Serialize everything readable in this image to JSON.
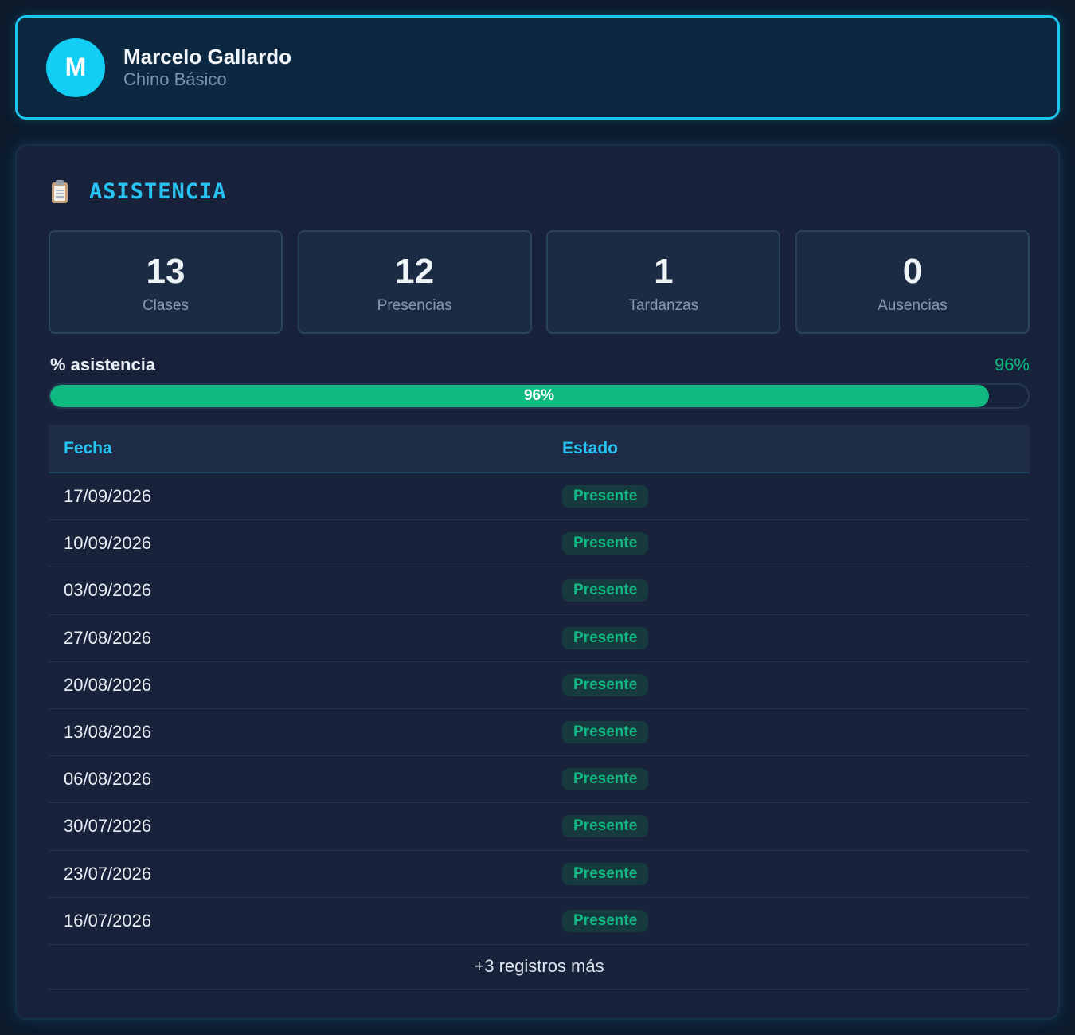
{
  "student": {
    "initial": "M",
    "name": "Marcelo Gallardo",
    "course": "Chino Básico"
  },
  "section": {
    "icon": "clipboard-icon",
    "title": "ASISTENCIA"
  },
  "stats": [
    {
      "value": "13",
      "label": "Clases"
    },
    {
      "value": "12",
      "label": "Presencias"
    },
    {
      "value": "1",
      "label": "Tardanzas"
    },
    {
      "value": "0",
      "label": "Ausencias"
    }
  ],
  "attendance": {
    "label": "% asistencia",
    "value_text": "96%",
    "percent": 96
  },
  "table": {
    "headers": {
      "date": "Fecha",
      "status": "Estado"
    },
    "rows": [
      {
        "date": "17/09/2026",
        "status": "Presente"
      },
      {
        "date": "10/09/2026",
        "status": "Presente"
      },
      {
        "date": "03/09/2026",
        "status": "Presente"
      },
      {
        "date": "27/08/2026",
        "status": "Presente"
      },
      {
        "date": "20/08/2026",
        "status": "Presente"
      },
      {
        "date": "13/08/2026",
        "status": "Presente"
      },
      {
        "date": "06/08/2026",
        "status": "Presente"
      },
      {
        "date": "30/07/2026",
        "status": "Presente"
      },
      {
        "date": "23/07/2026",
        "status": "Presente"
      },
      {
        "date": "16/07/2026",
        "status": "Presente"
      }
    ],
    "more_text": "+3 registros más"
  },
  "colors": {
    "accent": "#27c3f3",
    "success": "#10b981",
    "background": "#0c1a2c",
    "panel": "#18233b"
  }
}
